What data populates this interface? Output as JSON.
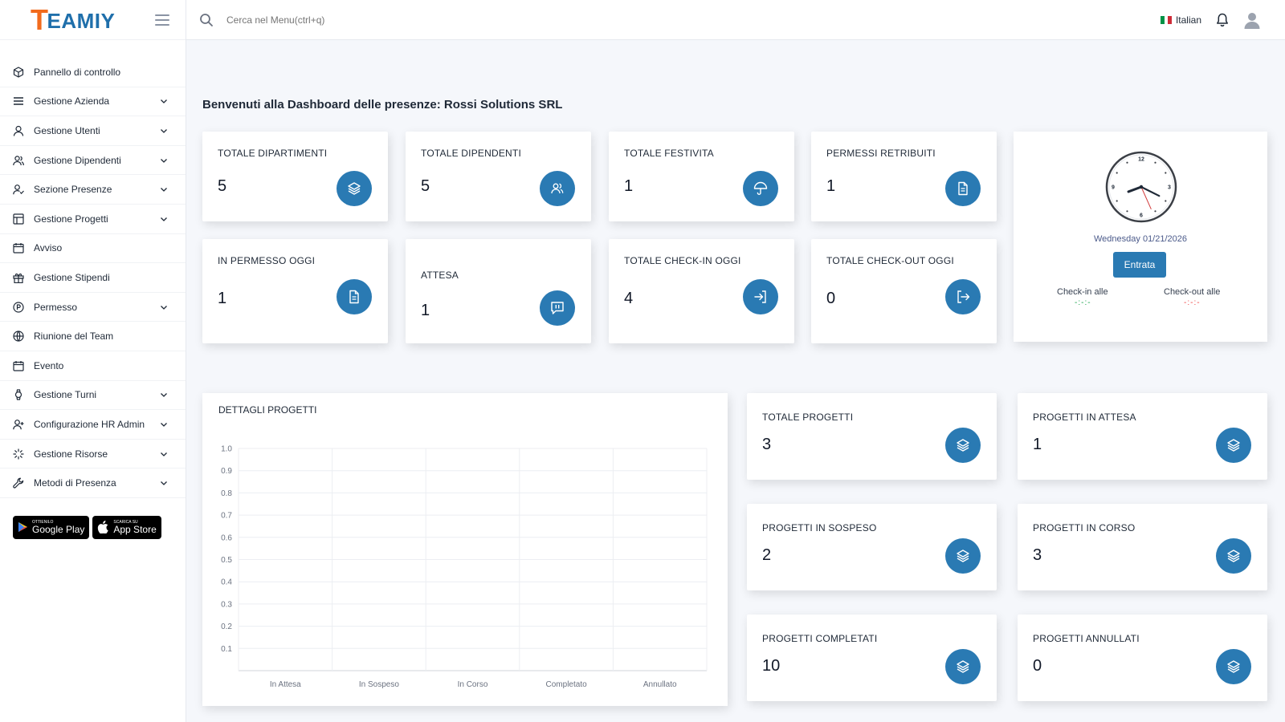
{
  "app": {
    "logo_t": "T",
    "logo_rest": "EAMIY"
  },
  "header": {
    "search_placeholder": "Cerca nel Menu(ctrl+q)",
    "language": "Italian",
    "flag_colors": [
      "#009246",
      "#ffffff",
      "#ce2b37"
    ]
  },
  "sidebar": {
    "items": [
      {
        "label": "Pannello di controllo",
        "icon": "cube-icon",
        "expandable": false
      },
      {
        "label": "Gestione Azienda",
        "icon": "bars-icon",
        "expandable": true
      },
      {
        "label": "Gestione Utenti",
        "icon": "user-icon",
        "expandable": true
      },
      {
        "label": "Gestione Dipendenti",
        "icon": "users-icon",
        "expandable": true
      },
      {
        "label": "Sezione Presenze",
        "icon": "user-check-icon",
        "expandable": true
      },
      {
        "label": "Gestione Progetti",
        "icon": "layout-icon",
        "expandable": true
      },
      {
        "label": "Avviso",
        "icon": "calendar-icon",
        "expandable": false
      },
      {
        "label": "Gestione Stipendi",
        "icon": "gift-icon",
        "expandable": false
      },
      {
        "label": "Permesso",
        "icon": "circle-p-icon",
        "expandable": true
      },
      {
        "label": "Riunione del Team",
        "icon": "globe-icon",
        "expandable": false
      },
      {
        "label": "Evento",
        "icon": "calendar-icon",
        "expandable": false
      },
      {
        "label": "Gestione Turni",
        "icon": "watch-icon",
        "expandable": true
      },
      {
        "label": "Configurazione HR Admin",
        "icon": "user-plus-icon",
        "expandable": true
      },
      {
        "label": "Gestione Risorse",
        "icon": "loader-icon",
        "expandable": true
      },
      {
        "label": "Metodi di Presenza",
        "icon": "tool-icon",
        "expandable": true
      }
    ],
    "stores": {
      "google_small": "OTTIENILO",
      "google_big": "Google Play",
      "apple_small": "Scarica su",
      "apple_big": "App Store"
    }
  },
  "main": {
    "welcome": "Benvenuti alla Dashboard delle presenze: Rossi Solutions SRL",
    "stats": [
      {
        "title": "TOTALE DIPARTIMENTI",
        "value": "5",
        "icon": "layers-icon"
      },
      {
        "title": "TOTALE DIPENDENTI",
        "value": "5",
        "icon": "users-icon"
      },
      {
        "title": "TOTALE FESTIVITA",
        "value": "1",
        "icon": "umbrella-icon"
      },
      {
        "title": "PERMESSI RETRIBUITI",
        "value": "1",
        "icon": "document-icon"
      },
      {
        "title": "IN PERMESSO OGGI",
        "value": "1",
        "icon": "document-icon"
      },
      {
        "title": "ATTESA",
        "value": "1",
        "icon": "message-pause-icon"
      },
      {
        "title": "TOTALE CHECK-IN OGGI",
        "value": "4",
        "icon": "login-icon"
      },
      {
        "title": "TOTALE CHECK-OUT OGGI",
        "value": "0",
        "icon": "logout-icon"
      }
    ],
    "clock": {
      "date": "Wednesday 01/21/2026",
      "button": "Entrata",
      "checkin_label": "Check-in alle",
      "checkin_value": "-:-:-",
      "checkout_label": "Check-out alle",
      "checkout_value": "-:-:-",
      "time": {
        "hour": 8,
        "minute": 19,
        "second": 26
      }
    },
    "projects": [
      {
        "title": "TOTALE PROGETTI",
        "value": "3"
      },
      {
        "title": "PROGETTI IN ATTESA",
        "value": "1"
      },
      {
        "title": "PROGETTI IN SOSPESO",
        "value": "2"
      },
      {
        "title": "PROGETTI IN CORSO",
        "value": "3"
      },
      {
        "title": "PROGETTI COMPLETATI",
        "value": "10"
      },
      {
        "title": "PROGETTI ANNULLATI",
        "value": "0"
      }
    ]
  },
  "colors": {
    "accent": "#2a7ab3",
    "checkin": "#16a34a",
    "checkout": "#ef4444"
  },
  "chart_data": {
    "type": "bar",
    "title": "DETTAGLI PROGETTI",
    "categories": [
      "In Attesa",
      "In Sospeso",
      "In Corso",
      "Completato",
      "Annullato"
    ],
    "values": [
      0,
      0,
      0,
      0,
      0
    ],
    "ylim": [
      0,
      1.0
    ],
    "yticks": [
      "0.1",
      "0.2",
      "0.3",
      "0.4",
      "0.5",
      "0.6",
      "0.7",
      "0.8",
      "0.9",
      "1.0"
    ],
    "grid": true
  }
}
